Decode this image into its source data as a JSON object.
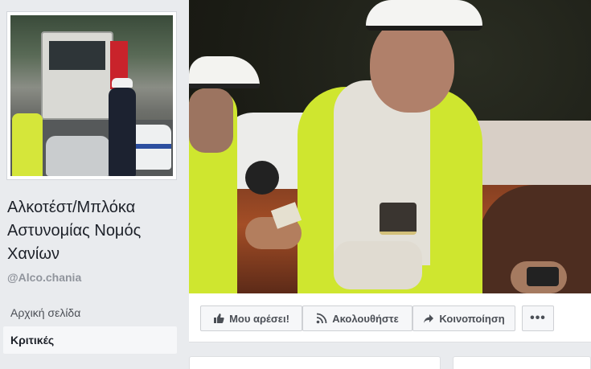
{
  "page": {
    "name": "Αλκοτέστ/Μπλόκα Αστυνομίας Νομός Χανίων",
    "handle": "@Alco.chania"
  },
  "nav": {
    "items": [
      {
        "label": "Αρχική σελίδα",
        "active": false
      },
      {
        "label": "Κριτικές",
        "active": true
      }
    ]
  },
  "actions": {
    "like_label": "Μου αρέσει!",
    "follow_label": "Ακολουθήστε",
    "share_label": "Κοινοποίηση",
    "more_label": "•••"
  },
  "icons": {
    "like": "thumbs-up-icon",
    "follow": "rss-icon",
    "share": "share-arrow-icon"
  },
  "colors": {
    "page_bg": "#e9ebee",
    "text_primary": "#1d2129",
    "text_secondary": "#90949c",
    "button_bg": "#f6f7f9"
  }
}
